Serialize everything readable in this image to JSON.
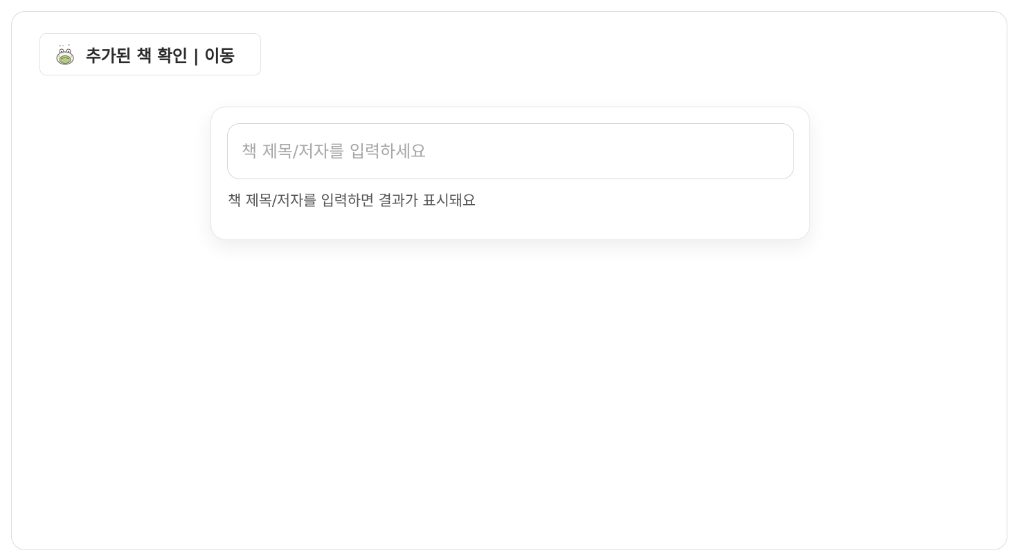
{
  "header": {
    "nav_button_label": "추가된 책 확인 | 이동",
    "logo_icon": "frog-mascot-icon"
  },
  "search": {
    "placeholder": "책 제목/저자를 입력하세요",
    "value": "",
    "hint": "책 제목/저자를 입력하면 결과가 표시돼요"
  },
  "colors": {
    "text_primary": "#2a2a2a",
    "placeholder": "#a6a6a6",
    "hint_text": "#555555",
    "border": "#dcdcdc",
    "mascot_green": "#b7c98a"
  }
}
